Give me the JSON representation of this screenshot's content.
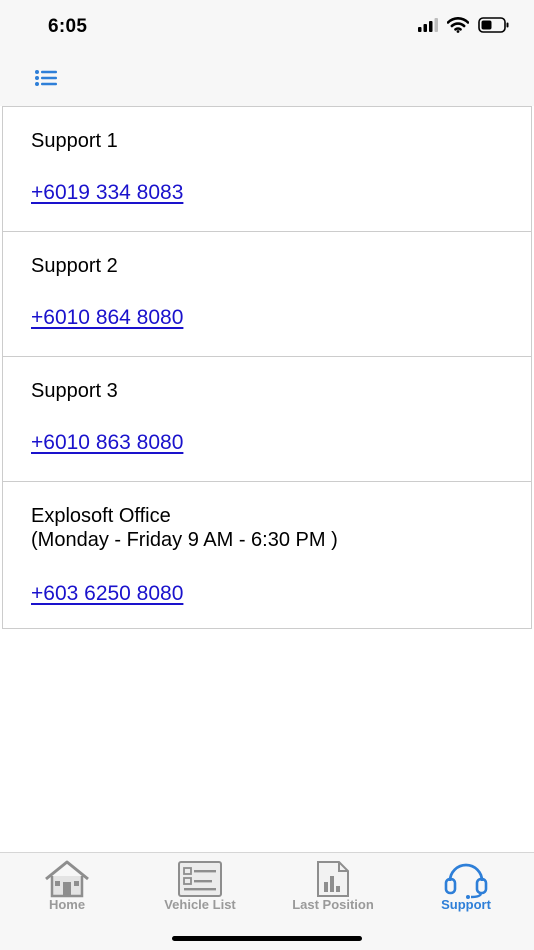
{
  "status_bar": {
    "time": "6:05",
    "icons": [
      "signal-icon",
      "wifi-icon",
      "battery-icon"
    ]
  },
  "nav": {
    "menu_icon": "list-menu-icon",
    "accent_color": "#2e7fd8"
  },
  "contacts": [
    {
      "title": "Support 1",
      "subtitle": "",
      "phone": "+6019 334 8083"
    },
    {
      "title": "Support 2",
      "subtitle": "",
      "phone": "+6010 864 8080"
    },
    {
      "title": "Support 3",
      "subtitle": "",
      "phone": "+6010 863 8080"
    },
    {
      "title": "Explosoft Office",
      "subtitle": "(Monday - Friday 9 AM - 6:30 PM )",
      "phone": "+603 6250 8080"
    }
  ],
  "link_color": "#1a12cc",
  "tabs": [
    {
      "label": "Home",
      "icon": "home-icon",
      "active": false
    },
    {
      "label": "Vehicle List",
      "icon": "checklist-icon",
      "active": false
    },
    {
      "label": "Last Position",
      "icon": "report-chart-icon",
      "active": false
    },
    {
      "label": "Support",
      "icon": "headset-icon",
      "active": true
    }
  ]
}
